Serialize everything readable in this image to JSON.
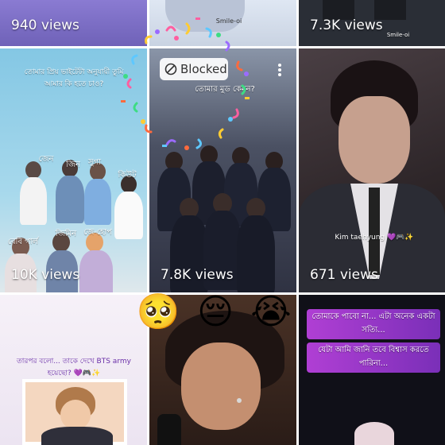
{
  "tiles": {
    "t1": {
      "views": "940 views"
    },
    "t2": {
      "caption": "Smile-oi"
    },
    "t3": {
      "views": "7.3K views",
      "caption": "Smile-oi"
    },
    "t4": {
      "views": "10K views",
      "caption_top": "তোমার প্রিয় ভাইটেটা অনুযায়ী তুমি আমার কি হতে চাও?",
      "labels": [
        "জেন",
        "জিন",
        "সুগা",
        "বেবি গার্ল",
        "জিমিন",
        "জে-হোপ",
        "কিউট",
        "তে"
      ]
    },
    "t5": {
      "views": "7.8K views",
      "caption_top": "তোমার মুড কেমন?",
      "blocked_label": "Blocked"
    },
    "t6": {
      "views": "671 views",
      "caption": "Kim taehyung 💜🎮✨"
    },
    "t7": {
      "caption": "তারপর বলো... তাকে দেখে BTS army হয়েছো? 💜🎮✨"
    },
    "t9": {
      "caption_1": "তোমাকে পাবো না... এটা অনেক একটা সত্যি...",
      "caption_2": "যেটা আমি জানি তবে বিশ্বাস করতে পারিনা..."
    }
  },
  "reactions": [
    "🥺",
    "😔",
    "😭"
  ],
  "colors": {
    "t1": "#7d6fc9",
    "t2": "#e8eef7",
    "t3": "#2b2f38",
    "t4": "#8dcbe6",
    "t5": "#34384a",
    "t6": "#3a3136",
    "t7": "#f2ecf6",
    "t8": "#3e2a22",
    "t9": "#0f0f16"
  }
}
